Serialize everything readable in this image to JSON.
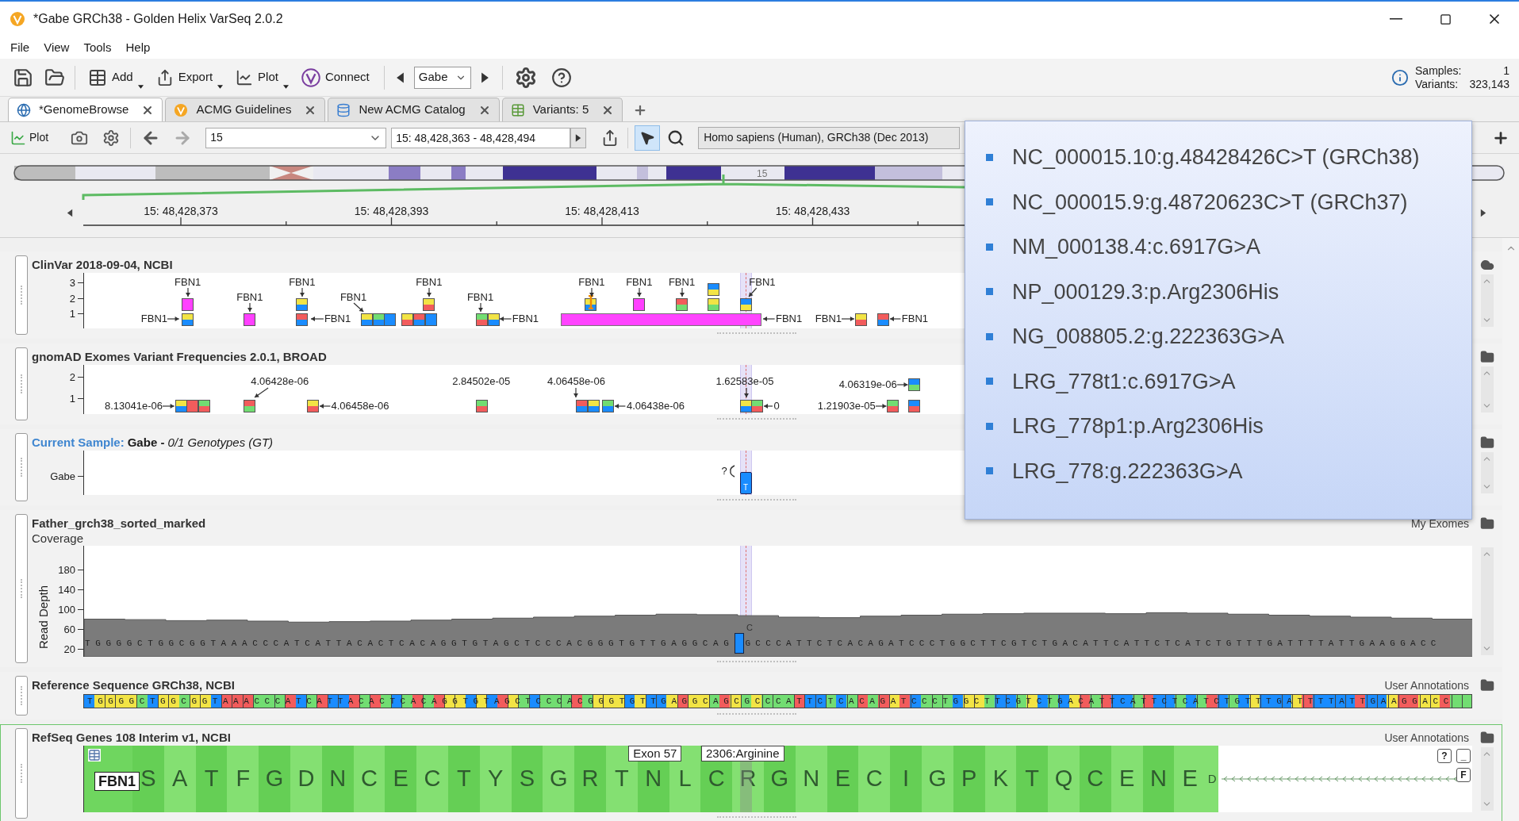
{
  "window": {
    "title": "*Gabe GRCh38 - Golden Helix VarSeq 2.0.2"
  },
  "menu": [
    {
      "label": "File"
    },
    {
      "label": "View"
    },
    {
      "label": "Tools"
    },
    {
      "label": "Help"
    }
  ],
  "toolbar": {
    "buttons": [
      {
        "kind": "add",
        "label": "Add"
      },
      {
        "kind": "export",
        "label": "Export"
      },
      {
        "kind": "plot",
        "label": "Plot"
      },
      {
        "kind": "connect",
        "label": "Connect"
      }
    ],
    "sample": "Gabe",
    "stats": [
      {
        "label": "Samples:",
        "value": "1"
      },
      {
        "label": "Variants:",
        "value": "323,143"
      }
    ]
  },
  "tabs": [
    {
      "label": "*GenomeBrowse",
      "selected": true
    },
    {
      "label": "ACMG Guidelines",
      "selected": false
    },
    {
      "label": "New ACMG Catalog",
      "selected": false
    },
    {
      "label": "Variants: 5",
      "selected": false
    }
  ],
  "browser_toolbar": {
    "plot_label": "Plot",
    "chromosome": "15",
    "range": "15: 48,428,363 - 48,428,494",
    "tools": [
      {
        "kind": "pointer",
        "selected": true
      },
      {
        "kind": "zoom",
        "selected": false
      }
    ],
    "genome": "Homo sapiens (Human), GRCh38 (Dec 2013)"
  },
  "ideogram": {
    "band_label": "15"
  },
  "ruler": {
    "ticks": [
      "15: 48,428,373",
      "15: 48,428,393",
      "15: 48,428,413",
      "15: 48,428,433"
    ]
  },
  "tracks": [
    {
      "kind": "clinvar",
      "title": "ClinVar 2018-09-04, NCBI",
      "selected": false,
      "y_ticks": [
        "3",
        "2",
        "1"
      ],
      "labels": [
        "FBN1",
        "FBN1",
        "FBN1",
        "FBN1",
        "FBN1",
        "FBN1",
        "FBN1",
        "FBN1",
        "FBN1",
        "FBN1",
        "FBN1",
        "FBN1",
        "FBN1",
        "FBN1",
        "FBN1",
        "FBN1"
      ]
    },
    {
      "kind": "frequency",
      "title": "gnomAD Exomes Variant Frequencies 2.0.1, BROAD",
      "selected": false,
      "y_ticks": [
        "2",
        "1"
      ],
      "labels": [
        "8.13041e-06",
        "4.06428e-06",
        "4.06458e-06",
        "2.84502e-05",
        "4.06458e-06",
        "4.06438e-06",
        "1.62583e-05",
        "0",
        "1.21903e-05",
        "4.06319e-06"
      ]
    },
    {
      "kind": "genotype",
      "label": "Current Sample:",
      "title": "**Gabe -** *0/1 Genotypes (GT)*",
      "selected": false,
      "sample": "Gabe",
      "unknown_mark": "?",
      "allele": "T"
    },
    {
      "kind": "coverage",
      "title": "Father_grch38_sorted_marked",
      "source": "My Exomes",
      "subtitle": "Coverage",
      "selected": false,
      "ylabel": "Read Depth",
      "y_ticks": [
        "180",
        "140",
        "100",
        "60",
        "20"
      ],
      "variant_base": "C",
      "sequence_left": "TGGGGCTGGCGGTAAACCCATCATTACACTCACAGGTGTAGCTCCCACGGGTGTTGAGGCAG",
      "sequence_right": "GCCCATTCTCACAGATCCCTGGCTTCGTCTGACATTCATTCTCATCTGTTTGATTTTATTGAAGGACC"
    },
    {
      "kind": "reference",
      "title": "Reference Sequence GRCh38, NCBI",
      "source": "User Annotations",
      "selected": false,
      "sequence": "TGGGGCTGGCGGTAAACCCATCATTACACTCACAGGTGTAGCTCCCACGGGTGTTGAGGCAGCGCCCATTCTCACAGATCCCTGGCTTCGTCTGACATTCATTCTCATCTGTTTGATTTTATTGAAGGACC"
    },
    {
      "kind": "gene",
      "title": "RefSeq Genes 108 Interim v1, NCBI",
      "source": "User Annotations",
      "selected": true,
      "gene": "FBN1",
      "exon": "Exon 57",
      "residue": "2306:Arginine",
      "amino_acids": [
        "S",
        "A",
        "T",
        "F",
        "G",
        "D",
        "N",
        "C",
        "E",
        "C",
        "T",
        "Y",
        "S",
        "G",
        "R",
        "T",
        "N",
        "L",
        "C",
        "R",
        "G",
        "N",
        "E",
        "C",
        "I",
        "G",
        "P",
        "K",
        "T",
        "Q",
        "C",
        "E",
        "N",
        "E"
      ],
      "partial_residue": "D",
      "buttons": [
        "?",
        "_",
        "F"
      ]
    }
  ],
  "popup": {
    "items": [
      "NC_000015.10:g.48428426C>T (GRCh38)",
      "NC_000015.9:g.48720623C>T (GRCh37)",
      "NM_000138.4:c.6917G>A",
      "NP_000129.3:p.Arg2306His",
      "NG_008805.2:g.222363G>A",
      "LRG_778t1:c.6917G>A",
      "LRG_778p1:p.Arg2306His",
      "LRG_778:g.222363G>A"
    ]
  }
}
